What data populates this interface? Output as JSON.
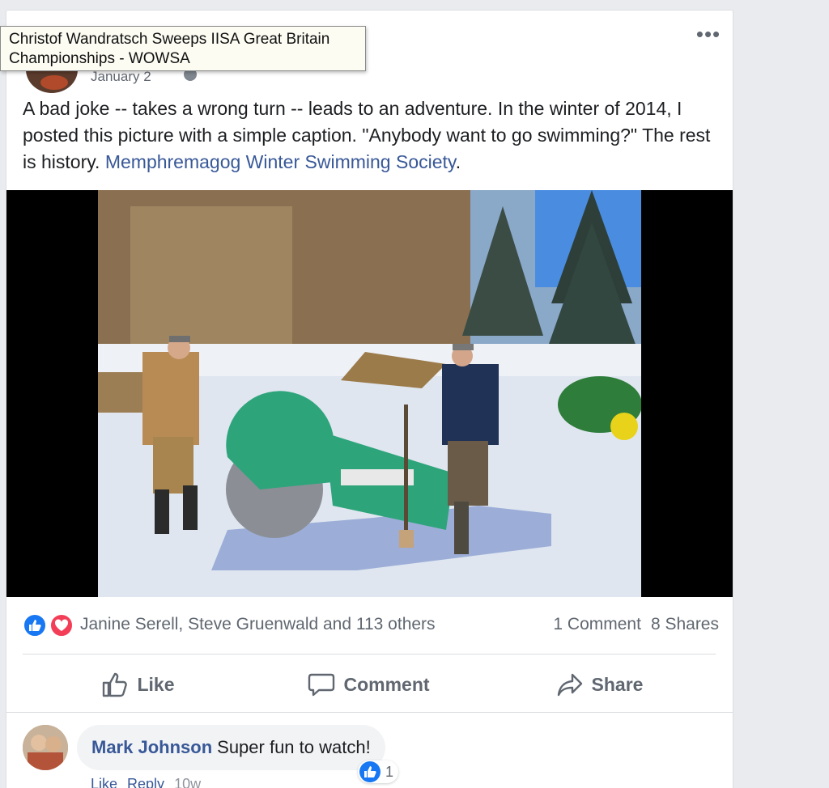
{
  "tooltip": {
    "text": "Christof Wandratsch Sweeps IISA Great Britain Championships - WOWSA"
  },
  "post": {
    "date": "January 2",
    "text_before": "A bad joke -- takes a wrong turn -- leads to an adventure. In the winter of 2014, I posted this picture with a simple caption. \"Anybody want to go swimming?\" The rest is history. ",
    "link_text": "Memphremagog Winter Swimming Society",
    "text_after": ".",
    "more_label": "•••"
  },
  "photo": {
    "icon": "photo-icon"
  },
  "reactions": {
    "names": "Janine Serell, Steve Gruenwald and 113 others",
    "comments": "1 Comment",
    "shares": "8 Shares",
    "colors": {
      "like": "#1877f2",
      "love": "#f33e58"
    }
  },
  "actions": {
    "like": "Like",
    "comment": "Comment",
    "share": "Share"
  },
  "comment": {
    "author": "Mark Johnson",
    "text": "Super fun to watch!",
    "reaction_count": "1",
    "meta_like": "Like",
    "meta_reply": "Reply",
    "meta_time": "10w"
  }
}
